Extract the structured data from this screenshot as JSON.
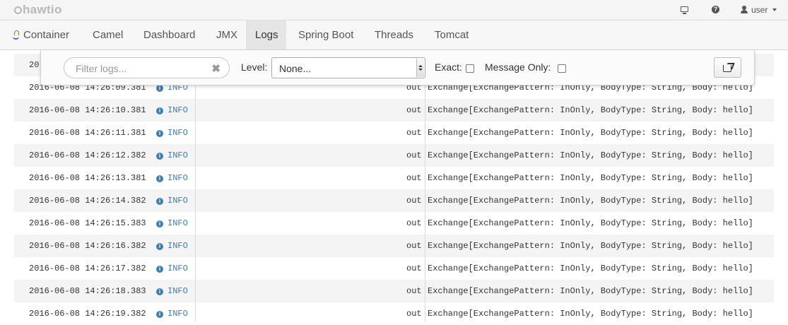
{
  "app": {
    "logo_text": "hawtio"
  },
  "topbar": {
    "user_label": "user"
  },
  "nav": {
    "tabs": [
      {
        "label": "Container",
        "active": false
      },
      {
        "label": "Camel",
        "active": false
      },
      {
        "label": "Dashboard",
        "active": false
      },
      {
        "label": "JMX",
        "active": false
      },
      {
        "label": "Logs",
        "active": true
      },
      {
        "label": "Spring Boot",
        "active": false
      },
      {
        "label": "Threads",
        "active": false
      },
      {
        "label": "Tomcat",
        "active": false
      }
    ]
  },
  "filter": {
    "search_placeholder": "Filter logs...",
    "clear_symbol": "✖",
    "level_label": "Level:",
    "level_value": "None...",
    "exact_label": "Exact:",
    "exact_checked": false,
    "message_only_label": "Message Only:",
    "message_only_checked": false
  },
  "logs": {
    "partial_first_row": "20",
    "rows": [
      {
        "timestamp": "2016-06-08 14:26:09.381",
        "level": "INFO",
        "direction": "out",
        "message": "Exchange[ExchangePattern: InOnly, BodyType: String, Body: hello]"
      },
      {
        "timestamp": "2016-06-08 14:26:10.381",
        "level": "INFO",
        "direction": "out",
        "message": "Exchange[ExchangePattern: InOnly, BodyType: String, Body: hello]"
      },
      {
        "timestamp": "2016-06-08 14:26:11.381",
        "level": "INFO",
        "direction": "out",
        "message": "Exchange[ExchangePattern: InOnly, BodyType: String, Body: hello]"
      },
      {
        "timestamp": "2016-06-08 14:26:12.382",
        "level": "INFO",
        "direction": "out",
        "message": "Exchange[ExchangePattern: InOnly, BodyType: String, Body: hello]"
      },
      {
        "timestamp": "2016-06-08 14:26:13.381",
        "level": "INFO",
        "direction": "out",
        "message": "Exchange[ExchangePattern: InOnly, BodyType: String, Body: hello]"
      },
      {
        "timestamp": "2016-06-08 14:26:14.382",
        "level": "INFO",
        "direction": "out",
        "message": "Exchange[ExchangePattern: InOnly, BodyType: String, Body: hello]"
      },
      {
        "timestamp": "2016-06-08 14:26:15.383",
        "level": "INFO",
        "direction": "out",
        "message": "Exchange[ExchangePattern: InOnly, BodyType: String, Body: hello]"
      },
      {
        "timestamp": "2016-06-08 14:26:16.382",
        "level": "INFO",
        "direction": "out",
        "message": "Exchange[ExchangePattern: InOnly, BodyType: String, Body: hello]"
      },
      {
        "timestamp": "2016-06-08 14:26:17.382",
        "level": "INFO",
        "direction": "out",
        "message": "Exchange[ExchangePattern: InOnly, BodyType: String, Body: hello]"
      },
      {
        "timestamp": "2016-06-08 14:26:18.383",
        "level": "INFO",
        "direction": "out",
        "message": "Exchange[ExchangePattern: InOnly, BodyType: String, Body: hello]"
      },
      {
        "timestamp": "2016-06-08 14:26:19.382",
        "level": "INFO",
        "direction": "out",
        "message": "Exchange[ExchangePattern: InOnly, BodyType: String, Body: hello]"
      }
    ]
  },
  "colors": {
    "info": "#3d7eb5",
    "row_alt": "#f4f4f4"
  },
  "icons": {
    "monitor": "monitor-icon",
    "help": "help-icon",
    "user": "user-icon",
    "container": "container-icon",
    "info": "info-icon",
    "export": "export-icon"
  }
}
